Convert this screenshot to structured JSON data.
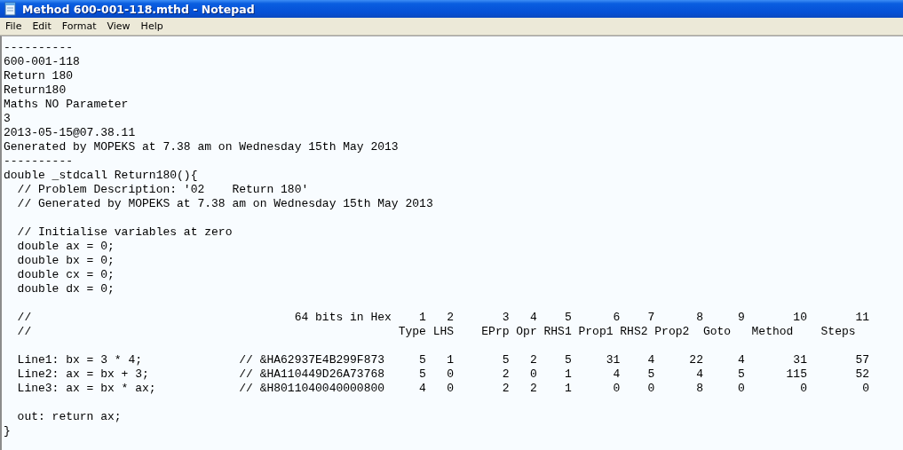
{
  "window": {
    "title": "Method 600-001-118.mthd - Notepad"
  },
  "menu": [
    {
      "label": "File"
    },
    {
      "label": "Edit"
    },
    {
      "label": "Format"
    },
    {
      "label": "View"
    },
    {
      "label": "Help"
    }
  ],
  "document": {
    "blocks": [
      [
        "----------",
        "600-001-118",
        "Return 180",
        "Return180",
        "Maths NO Parameter",
        "3",
        "2013-05-15@07.38.11",
        "Generated by MOPEKS at 7.38 am on Wednesday 15th May 2013",
        "----------",
        "double _stdcall Return180(){",
        "  // Problem Description: '02    Return 180'",
        "  // Generated by MOPEKS at 7.38 am on Wednesday 15th May 2013"
      ],
      [
        "  // Initialise variables at zero",
        "  double ax = 0;",
        "  double bx = 0;",
        "  double cx = 0;",
        "  double dx = 0;"
      ],
      [
        "  //                                      64 bits in Hex    1   2       3   4    5      6    7      8     9       10       11",
        "  //                                                     Type LHS    EPrp Opr RHS1 Prop1 RHS2 Prop2  Goto   Method    Steps"
      ],
      [
        "  Line1: bx = 3 * 4;              // &HA62937E4B299F873     5   1       5   2    5     31    4     22     4       31       57",
        "  Line2: ax = bx + 3;             // &HA110449D26A73768     5   0       2   0    1      4    5      4     5      115       52",
        "  Line3: ax = bx * ax;            // &H8011040040000800     4   0       2   2    1      0    0      8     0        0        0"
      ],
      [
        "  out: return ax;",
        "}"
      ]
    ]
  }
}
